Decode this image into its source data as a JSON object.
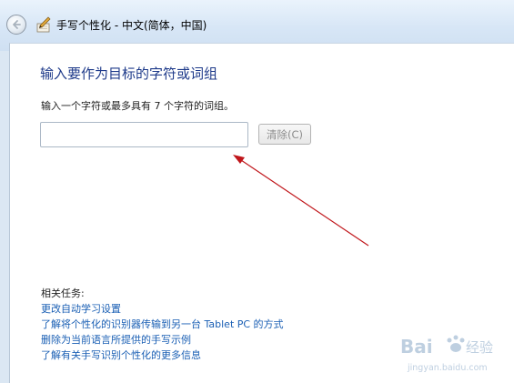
{
  "window": {
    "title": "手写个性化 - 中文(简体，中国)"
  },
  "icons": {
    "back": "back-arrow-icon",
    "app": "pen-paper-icon"
  },
  "main": {
    "heading": "输入要作为目标的字符或词组",
    "instruction": "输入一个字符或最多具有 7 个字符的词组。",
    "input_value": "",
    "clear_button": "清除(C)"
  },
  "related": {
    "heading": "相关任务:",
    "links": [
      "更改自动学习设置",
      "了解将个性化的识别器传输到另一台 Tablet PC 的方式",
      "删除为当前语言所提供的手写示例",
      "了解有关手写识别个性化的更多信息"
    ]
  },
  "watermark": {
    "brand": "Bai",
    "brand_suffix": "经验",
    "url": "jingyan.baidu.com"
  },
  "colors": {
    "heading": "#1e3a8a",
    "link": "#1a5fb4",
    "annotation_arrow": "#c0161b"
  }
}
